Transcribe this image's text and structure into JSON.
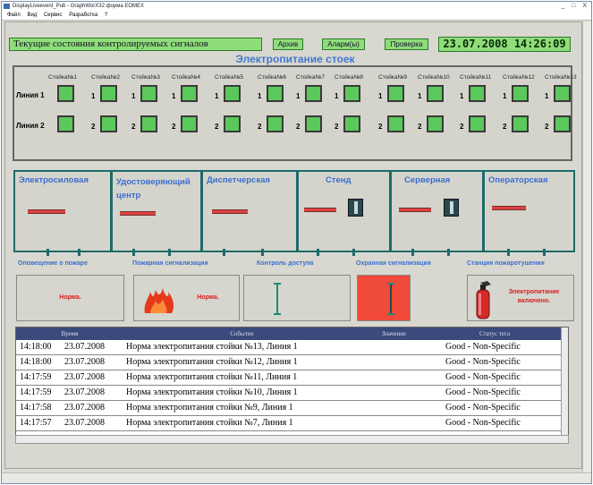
{
  "window": {
    "title": "DisplayLiveevent_Pub - GraphWorX32 форма ЕОМЕХ",
    "controls": "_ □ X"
  },
  "menu": [
    "Файл",
    "Вид",
    "Сервис",
    "Разработка",
    "?"
  ],
  "top": {
    "signals": "Текущие состояния контролируемых сигналов",
    "archive": "Архив",
    "alarms": "Аларм(ы)",
    "check": "Проверка",
    "datetime": "23.07.2008 14:26:09"
  },
  "racks": {
    "title": "Электропитание стоек",
    "line1": "Линия 1",
    "line2": "Линия 2",
    "labels": [
      "Стойка№1",
      "Стойка№2",
      "Стойка№3",
      "Стойка№4",
      "Стойка№5",
      "Стойка№6",
      "Стойка№7",
      "Стойка№8",
      "Стойка№9",
      "Стойка№10",
      "Стойка№11",
      "Стойка№12",
      "Стойка№13"
    ],
    "n1": "1",
    "n2": "2"
  },
  "rooms": [
    "Электросиловая",
    "Удостоверяющий центр",
    "Диспетчерская",
    "Стенд",
    "Серверная",
    "Операторская"
  ],
  "systems": {
    "warn": "Оповещение о пожаре",
    "fire": "Пожарная сигнализация",
    "access": "Контроль доступа",
    "guard": "Охранная сигнализация",
    "station": "Станция пожаротушения",
    "warn_status": "Норма.",
    "fire_status": "Норма.",
    "station_status": "Электропитание включено."
  },
  "table": {
    "headers": [
      "Время",
      "Событие",
      "Значение",
      "Статус тега"
    ],
    "rows": [
      [
        "14:18:00",
        "23.07.2008",
        "Норма электропитания стойки №13, Линия 1",
        "Good - Non-Specific"
      ],
      [
        "14:18:00",
        "23.07.2008",
        "Норма электропитания стойки №12, Линия 1",
        "Good - Non-Specific"
      ],
      [
        "14:17:59",
        "23.07.2008",
        "Норма электропитания стойки №11, Линия 1",
        "Good - Non-Specific"
      ],
      [
        "14:17:59",
        "23.07.2008",
        "Норма электропитания стойки №10, Линия 1",
        "Good - Non-Specific"
      ],
      [
        "14:17:58",
        "23.07.2008",
        "Норма электропитания стойки №9, Линия 1",
        "Good - Non-Specific"
      ],
      [
        "14:17:57",
        "23.07.2008",
        "Норма электропитания стойки №7, Линия 1",
        "Good - Non-Specific"
      ]
    ]
  }
}
